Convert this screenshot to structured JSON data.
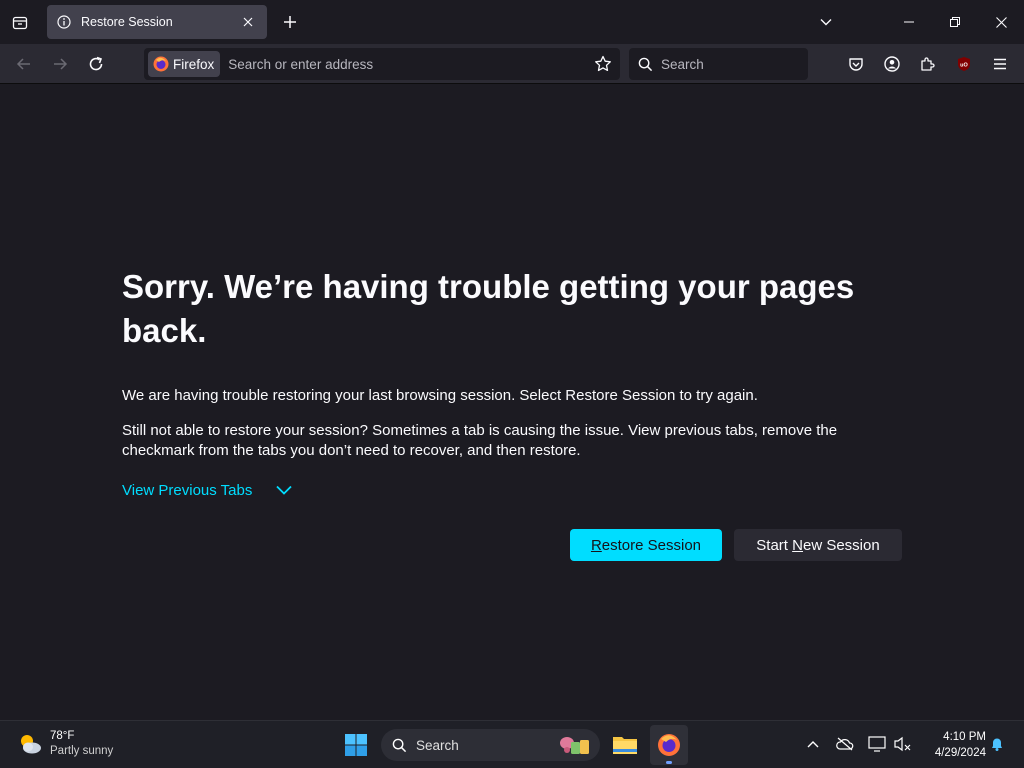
{
  "browser": {
    "tab": {
      "title": "Restore Session"
    },
    "url_identity_label": "Firefox",
    "url_placeholder": "Search or enter address",
    "search_placeholder": "Search"
  },
  "page": {
    "heading": "Sorry. We’re having trouble getting your pages back.",
    "paragraph1": "We are having trouble restoring your last browsing session. Select Restore Session to try again.",
    "paragraph2": "Still not able to restore your session? Sometimes a tab is causing the issue. View previous tabs, remove the checkmark from the tabs you don’t need to recover, and then restore.",
    "view_previous_tabs": "View Previous Tabs",
    "restore_button": {
      "accesskey": "R",
      "rest": "estore Session"
    },
    "new_session_button": {
      "before": "Start ",
      "accesskey": "N",
      "after": "ew Session"
    },
    "accent_color": "#00ddff"
  },
  "taskbar": {
    "weather": {
      "temp": "78°F",
      "condition": "Partly sunny"
    },
    "search_label": "Search",
    "clock": {
      "time": "4:10 PM",
      "date": "4/29/2024"
    }
  }
}
